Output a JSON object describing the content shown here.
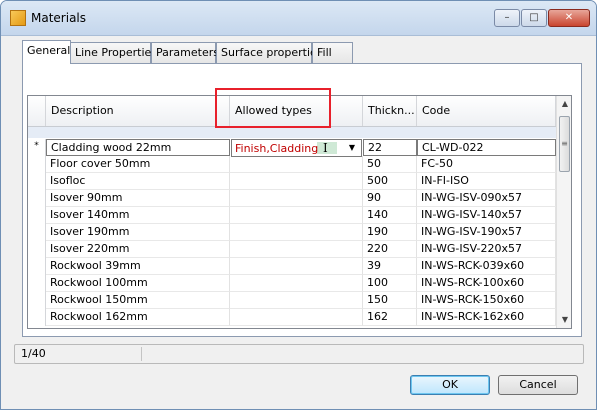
{
  "window": {
    "title": "Materials",
    "icon": "app-icon"
  },
  "title_buttons": {
    "minimize": "–",
    "maximize": "□",
    "close": "✕"
  },
  "tabs": [
    "General",
    "Line Properties",
    "Parameters",
    "Surface properties",
    "Fill"
  ],
  "active_tab": "General",
  "grid": {
    "columns": [
      "Description",
      "Allowed types",
      "Thickn...",
      "Code"
    ],
    "current_row_marker": "*",
    "editor": {
      "value": "Finish,Cladding",
      "arrow": "▼",
      "cursor": "I"
    },
    "rows": [
      {
        "description": "Cladding wood 22mm",
        "allowed": "Finish,Cladding",
        "thickness": "22",
        "code": "CL-WD-022"
      },
      {
        "description": "Floor cover 50mm",
        "allowed": "",
        "thickness": "50",
        "code": "FC-50"
      },
      {
        "description": "Isofloc",
        "allowed": "",
        "thickness": "500",
        "code": "IN-FI-ISO"
      },
      {
        "description": "Isover 90mm",
        "allowed": "",
        "thickness": "90",
        "code": "IN-WG-ISV-090x57"
      },
      {
        "description": "Isover 140mm",
        "allowed": "",
        "thickness": "140",
        "code": "IN-WG-ISV-140x57"
      },
      {
        "description": "Isover 190mm",
        "allowed": "",
        "thickness": "190",
        "code": "IN-WG-ISV-190x57"
      },
      {
        "description": "Isover 220mm",
        "allowed": "",
        "thickness": "220",
        "code": "IN-WG-ISV-220x57"
      },
      {
        "description": "Rockwool 39mm",
        "allowed": "",
        "thickness": "39",
        "code": "IN-WS-RCK-039x60"
      },
      {
        "description": "Rockwool 100mm",
        "allowed": "",
        "thickness": "100",
        "code": "IN-WS-RCK-100x60"
      },
      {
        "description": "Rockwool 150mm",
        "allowed": "",
        "thickness": "150",
        "code": "IN-WS-RCK-150x60"
      },
      {
        "description": "Rockwool 162mm",
        "allowed": "",
        "thickness": "162",
        "code": "IN-WS-RCK-162x60"
      }
    ],
    "scroll_up": "▲",
    "scroll_down": "▼",
    "scroll_grip": "≡"
  },
  "status": {
    "count": "1/40"
  },
  "buttons": {
    "ok": "OK",
    "cancel": "Cancel"
  },
  "colors": {
    "highlight": "#e8202b",
    "editor_text": "#c00000"
  }
}
